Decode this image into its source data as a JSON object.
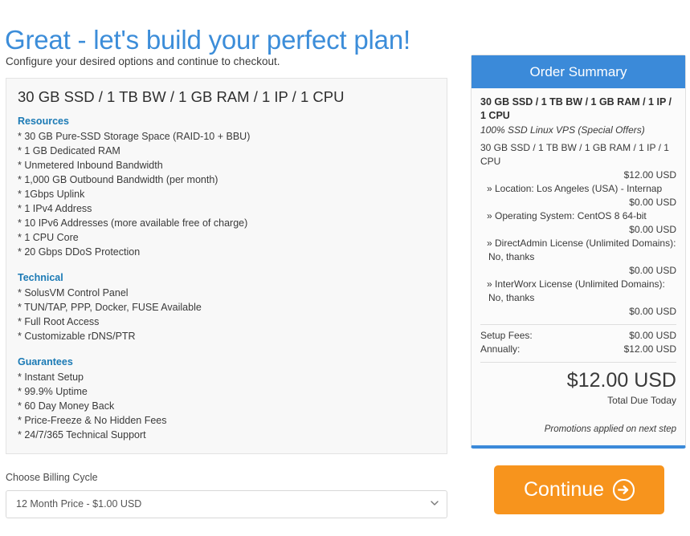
{
  "header": {
    "title": "Great - let's build your perfect plan!",
    "subtitle": "Configure your desired options and continue to checkout."
  },
  "product_panel": {
    "name": "30 GB SSD / 1 TB BW / 1 GB RAM / 1 IP / 1 CPU",
    "groups": [
      {
        "heading": "Resources",
        "items": [
          "* 30 GB Pure-SSD Storage Space (RAID-10 + BBU)",
          "* 1 GB Dedicated RAM",
          "* Unmetered Inbound Bandwidth",
          "* 1,000 GB Outbound Bandwidth (per month)",
          "* 1Gbps Uplink",
          "* 1 IPv4 Address",
          "* 10 IPv6 Addresses (more available free of charge)",
          "* 1 CPU Core",
          "* 20 Gbps DDoS Protection"
        ]
      },
      {
        "heading": "Technical",
        "items": [
          "* SolusVM Control Panel",
          "* TUN/TAP, PPP, Docker, FUSE Available",
          "* Full Root Access",
          "* Customizable rDNS/PTR"
        ]
      },
      {
        "heading": "Guarantees",
        "items": [
          "* Instant Setup",
          "* 99.9% Uptime",
          "* 60 Day Money Back",
          "* Price-Freeze & No Hidden Fees",
          "* 24/7/365 Technical Support"
        ]
      }
    ]
  },
  "billing": {
    "label": "Choose Billing Cycle",
    "selected": "12 Month Price - $1.00 USD",
    "options": [
      "12 Month Price - $1.00 USD"
    ]
  },
  "order_summary": {
    "header": "Order Summary",
    "product_title": "30 GB SSD / 1 TB BW / 1 GB RAM / 1 IP / 1 CPU",
    "product_subtitle": "100% SSD Linux VPS (Special Offers)",
    "base_line": "30 GB SSD / 1 TB BW / 1 GB RAM / 1 IP / 1 CPU",
    "base_price": "$12.00 USD",
    "configs": [
      {
        "label": "» Location: Los Angeles (USA) - Internap",
        "price": "$0.00 USD"
      },
      {
        "label": "» Operating System: CentOS 8 64-bit",
        "price": "$0.00 USD"
      },
      {
        "label": "» DirectAdmin License (Unlimited Domains): No, thanks",
        "price": "$0.00 USD"
      },
      {
        "label": "» InterWorx License (Unlimited Domains): No, thanks",
        "price": "$0.00 USD"
      }
    ],
    "setup_fees_label": "Setup Fees:",
    "setup_fees_value": "$0.00 USD",
    "recurring_label": "Annually:",
    "recurring_value": "$12.00 USD",
    "grand_total": "$12.00 USD",
    "grand_total_label": "Total Due Today",
    "promo_note": "Promotions applied on next step"
  },
  "continue": {
    "label": "Continue"
  },
  "colors": {
    "brand_blue": "#3b8ad9",
    "heading_blue": "#3c8dd9",
    "section_blue": "#1b7ab5",
    "accent_orange": "#f7941d",
    "panel_bg": "#f8f8f8"
  }
}
